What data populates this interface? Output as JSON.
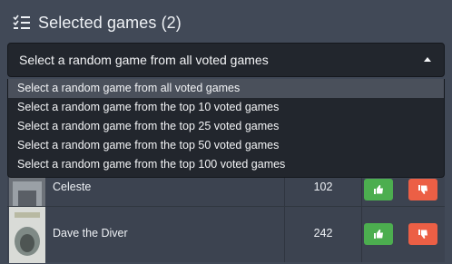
{
  "header": {
    "title": "Selected games (2)",
    "icon": "list-check-icon"
  },
  "select": {
    "value": "Select a random game from all voted games",
    "options": [
      "Select a random game from all voted games",
      "Select a random game from the top 10 voted games",
      "Select a random game from the top 25 voted games",
      "Select a random game from the top 50 voted games",
      "Select a random game from the top 100 voted games"
    ]
  },
  "games": [
    {
      "name": "Celeste",
      "votes": "102"
    },
    {
      "name": "Dave the Diver",
      "votes": "242"
    }
  ],
  "colors": {
    "background": "#414957",
    "dropdown": "#22262d",
    "upvote": "#4cae4f",
    "downvote": "#ec5f45"
  }
}
